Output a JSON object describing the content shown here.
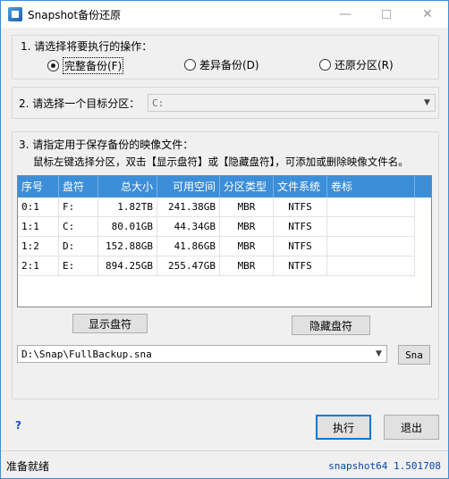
{
  "window": {
    "title": "Snapshot备份还原"
  },
  "operation_group": {
    "label": "1. 请选择将要执行的操作：",
    "options": [
      {
        "label": "完整备份(F)",
        "selected": true
      },
      {
        "label": "差异备份(D)",
        "selected": false
      },
      {
        "label": "还原分区(R)",
        "selected": false
      }
    ]
  },
  "target_group": {
    "label": "2. 请选择一个目标分区：",
    "combo_value": "C:"
  },
  "image_group": {
    "label": "3. 请指定用于保存备份的映像文件：",
    "hint": "鼠标左键选择分区，双击【显示盘符】或【隐藏盘符】，可添加或删除映像文件名。",
    "columns": [
      "序号",
      "盘符",
      "总大小",
      "可用空间",
      "分区类型",
      "文件系统",
      "卷标"
    ],
    "rows": [
      [
        "0:1",
        "F:",
        "1.82TB",
        "241.38GB",
        "MBR",
        "NTFS",
        ""
      ],
      [
        "1:1",
        "C:",
        "80.01GB",
        "44.34GB",
        "MBR",
        "NTFS",
        ""
      ],
      [
        "1:2",
        "D:",
        "152.88GB",
        "41.86GB",
        "MBR",
        "NTFS",
        ""
      ],
      [
        "2:1",
        "E:",
        "894.25GB",
        "255.47GB",
        "MBR",
        "NTFS",
        ""
      ]
    ],
    "show_drive_button": "显示盘符",
    "hide_drive_button": "隐藏盘符",
    "path_value": "D:\\Snap\\FullBackup.sna",
    "browse_button": "Sna"
  },
  "footer": {
    "help_icon": "?",
    "execute_button": "执行",
    "exit_button": "退出"
  },
  "status": {
    "text": "准备就绪",
    "version": "snapshot64 1.501708"
  }
}
